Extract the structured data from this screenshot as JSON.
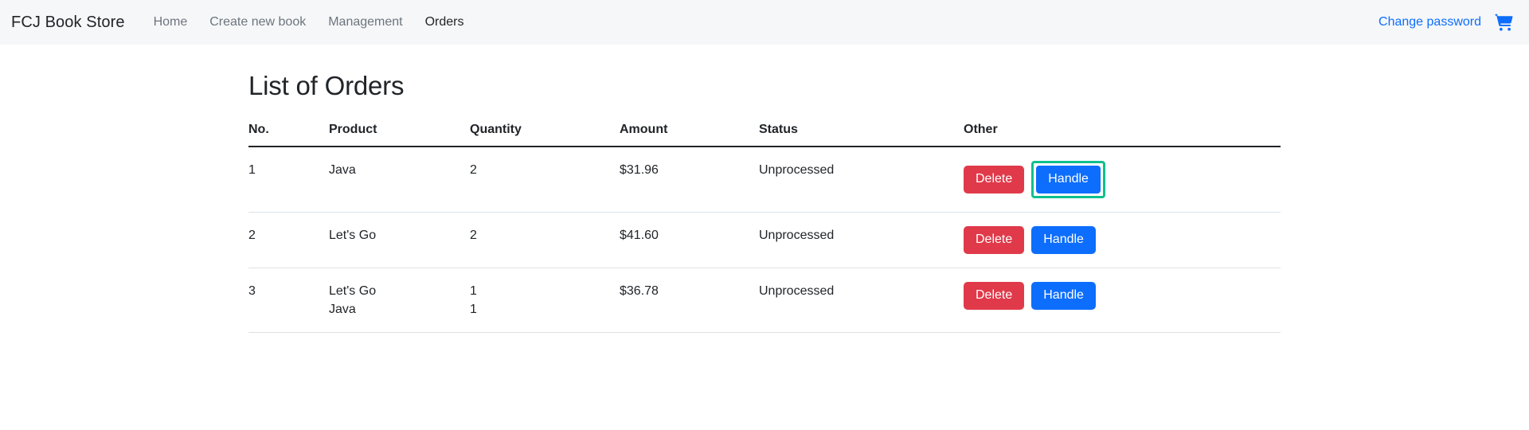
{
  "navbar": {
    "brand": "FCJ Book Store",
    "links": [
      {
        "label": "Home",
        "active": false
      },
      {
        "label": "Create new book",
        "active": false
      },
      {
        "label": "Management",
        "active": false
      },
      {
        "label": "Orders",
        "active": true
      }
    ],
    "change_password_label": "Change password",
    "cart_icon": "shopping-cart-icon",
    "background_color": "#f6f7f9",
    "link_color": "#6c757d",
    "active_link_color": "#212529",
    "accent_color": "#0d6efd"
  },
  "main": {
    "page_title": "List of Orders",
    "table": {
      "columns": [
        "No.",
        "Product",
        "Quantity",
        "Amount",
        "Status",
        "Other"
      ],
      "rows": [
        {
          "no": "1",
          "products": [
            "Java"
          ],
          "quantities": [
            "2"
          ],
          "amount": "$31.96",
          "status": "Unprocessed",
          "delete_label": "Delete",
          "handle_label": "Handle",
          "handle_focused": true
        },
        {
          "no": "2",
          "products": [
            "Let's Go"
          ],
          "quantities": [
            "2"
          ],
          "amount": "$41.60",
          "status": "Unprocessed",
          "delete_label": "Delete",
          "handle_label": "Handle",
          "handle_focused": false
        },
        {
          "no": "3",
          "products": [
            "Let's Go",
            "Java"
          ],
          "quantities": [
            "1",
            "1"
          ],
          "amount": "$36.78",
          "status": "Unprocessed",
          "delete_label": "Delete",
          "handle_label": "Handle",
          "handle_focused": false
        }
      ]
    }
  },
  "colors": {
    "delete_button": "#e03a4a",
    "handle_button": "#0d6efd",
    "focus_outline": "#0fc08d",
    "header_rule": "#212529",
    "row_rule": "#dee2e6"
  }
}
